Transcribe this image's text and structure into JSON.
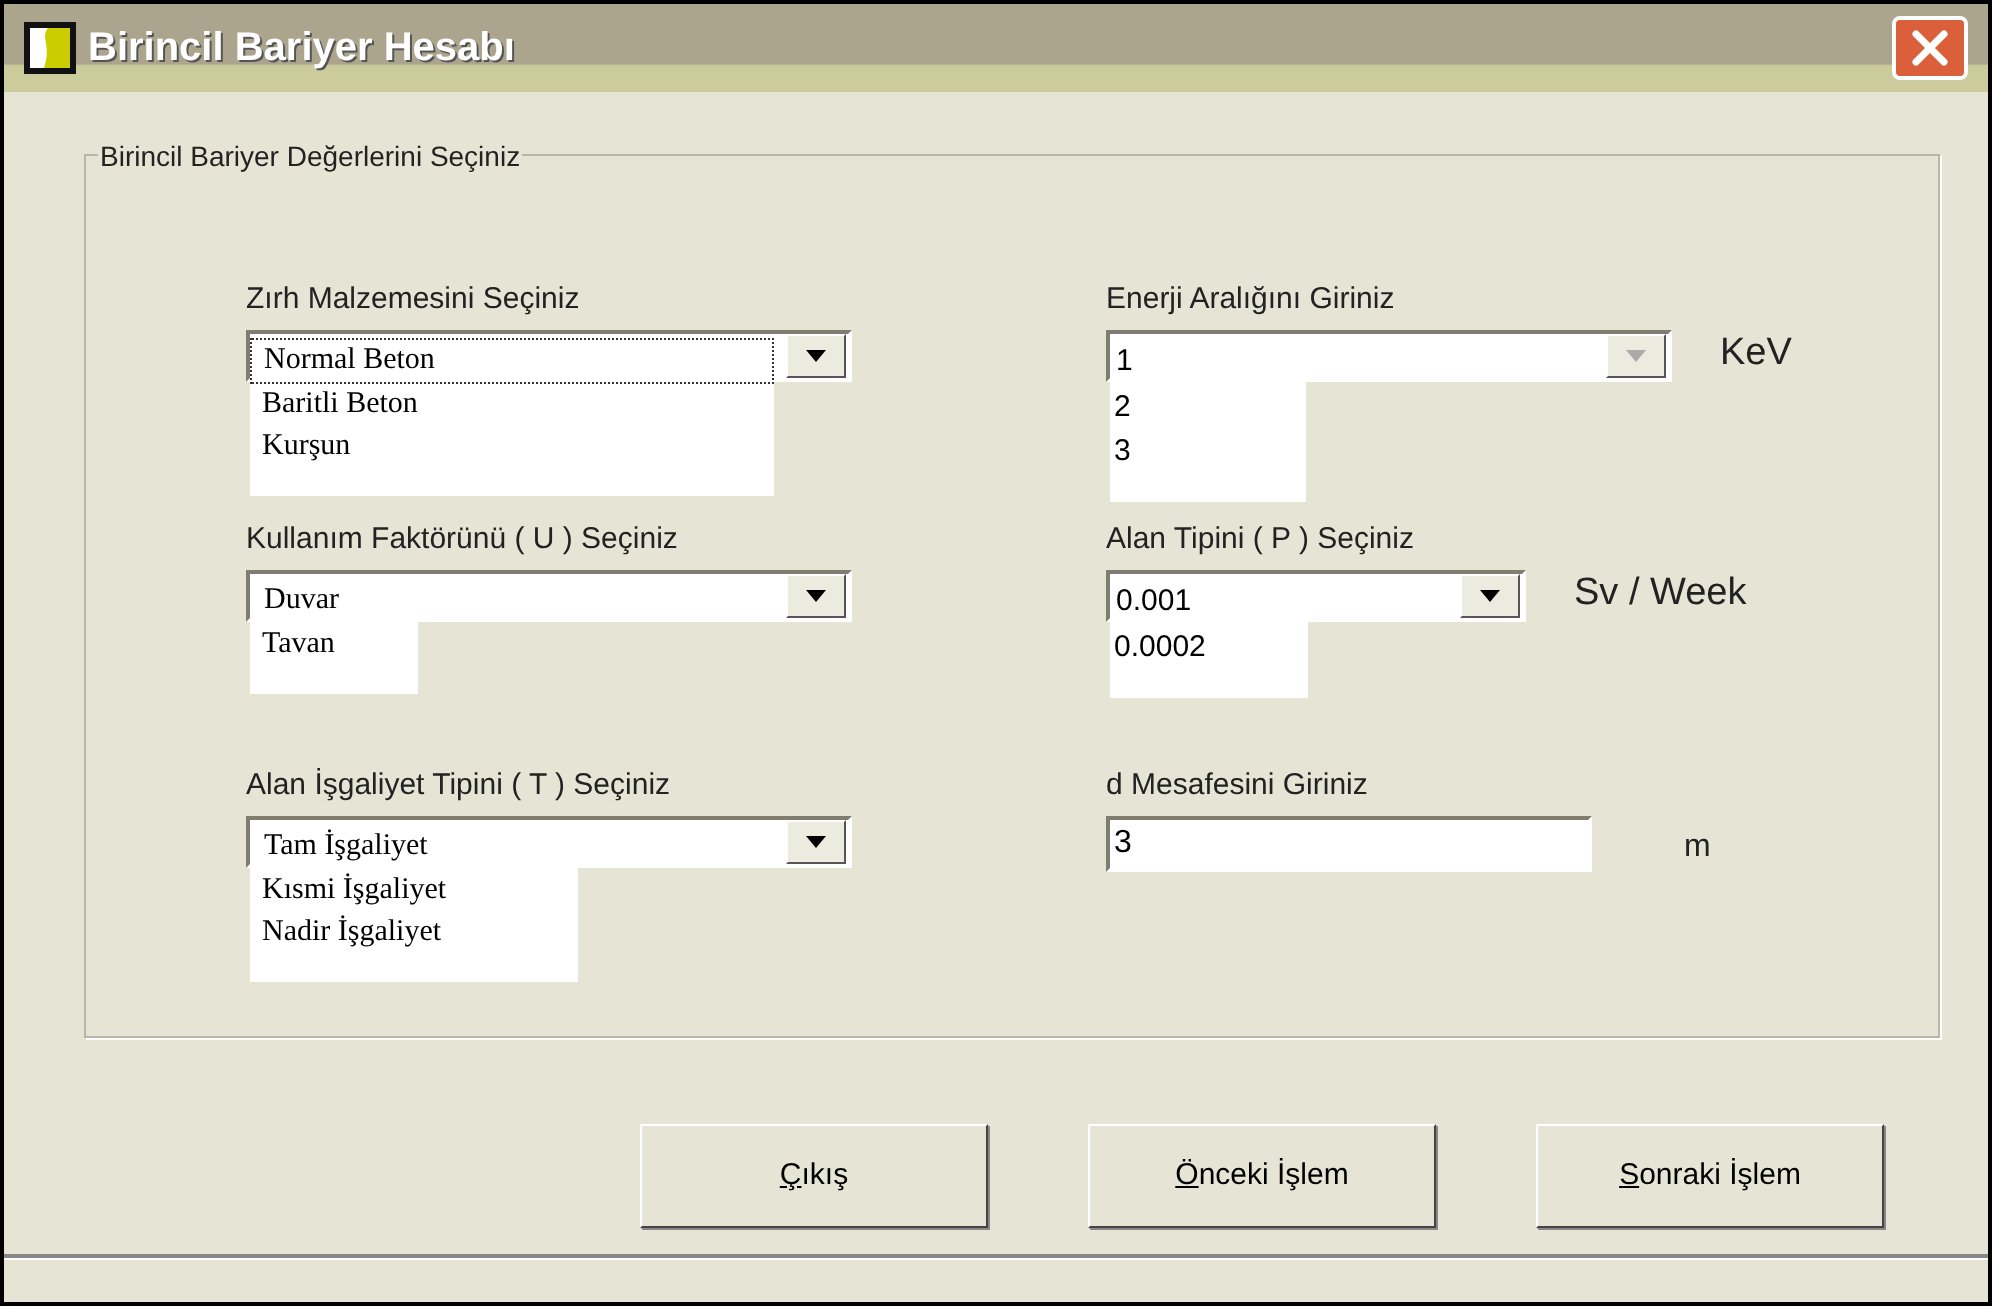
{
  "window": {
    "title": "Birincil Bariyer Hesabı"
  },
  "group": {
    "title": "Birincil Bariyer Değerlerini Seçiniz"
  },
  "left_fields": [
    {
      "label": "Zırh Malzemesini Seçiniz",
      "items": [
        "Normal Beton",
        "Baritli Beton",
        "Kurşun"
      ],
      "focused": true,
      "disabled": false
    },
    {
      "label": "Kullanım Faktörünü ( U ) Seçiniz",
      "items": [
        "Duvar",
        "Tavan"
      ],
      "focused": false,
      "disabled": false
    },
    {
      "label": "Alan İşgaliyet Tipini ( T ) Seçiniz",
      "items": [
        "Tam İşgaliyet",
        "Kısmi İşgaliyet",
        "Nadir İşgaliyet"
      ],
      "focused": false,
      "disabled": false
    }
  ],
  "right_fields": [
    {
      "kind": "combo",
      "label": "Enerji Aralığını Giriniz",
      "items": [
        "1",
        "2",
        "3"
      ],
      "unit": "KeV",
      "focused": false,
      "disabled": true
    },
    {
      "kind": "combo",
      "label": "Alan Tipini ( P ) Seçiniz",
      "items": [
        "0.001",
        "0.0002"
      ],
      "unit": "Sv / Week",
      "focused": false,
      "disabled": false
    },
    {
      "kind": "text",
      "label": "d Mesafesini Giriniz",
      "value": "3",
      "unit": "m"
    }
  ],
  "buttons": [
    {
      "label": "Çıkış"
    },
    {
      "label": "Önceki İşlem"
    },
    {
      "label": "Sonraki İşlem"
    }
  ]
}
